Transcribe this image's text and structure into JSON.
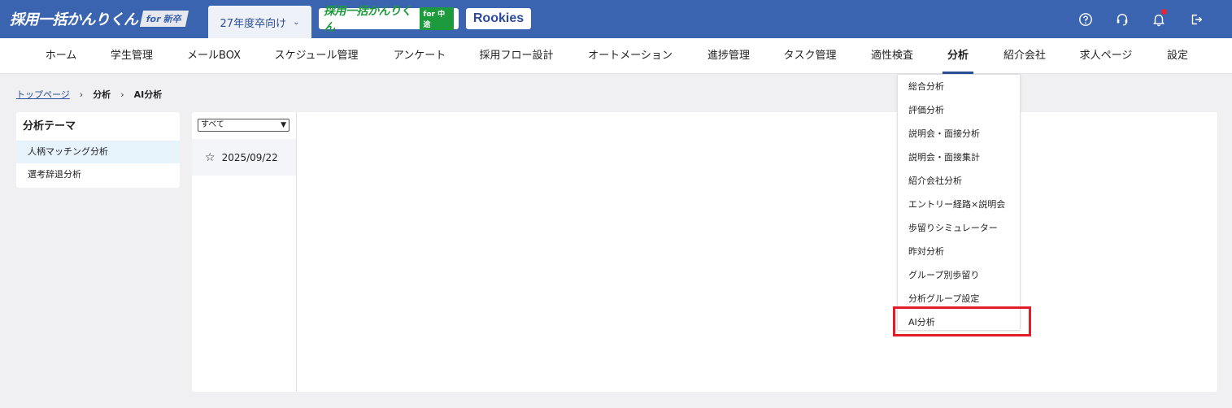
{
  "header": {
    "logo_main": "採用一括かんりくん",
    "logo_main_badge": "for 新卒",
    "year_selector": "27年度卒向け",
    "logo_mid": "採用一括かんりくん",
    "logo_mid_badge": "for 中途",
    "logo_rookies": "Rookies",
    "icons": [
      "help-icon",
      "support-headset-icon",
      "bell-icon",
      "logout-icon"
    ]
  },
  "nav": {
    "items": [
      "ホーム",
      "学生管理",
      "メールBOX",
      "スケジュール管理",
      "アンケート",
      "採用フロー設計",
      "オートメーション",
      "進捗管理",
      "タスク管理",
      "適性検査",
      "分析",
      "紹介会社",
      "求人ページ",
      "設定"
    ],
    "active": "分析"
  },
  "breadcrumb": {
    "home": "トップページ",
    "level1": "分析",
    "current": "AI分析"
  },
  "sidebar": {
    "title": "分析テーマ",
    "items": [
      "人柄マッチング分析",
      "選考辞退分析"
    ]
  },
  "list": {
    "filter": "すべて",
    "entries": [
      "2025/09/22"
    ]
  },
  "dropdown": {
    "items": [
      "総合分析",
      "評価分析",
      "説明会・面接分析",
      "説明会・面接集計",
      "紹介会社分析",
      "エントリー経路×説明会",
      "歩留りシミュレーター",
      "昨対分析",
      "グループ別歩留り",
      "分析グループ設定",
      "AI分析"
    ]
  },
  "colors": {
    "header_bg": "#3a63b0",
    "accent": "#2a4f95",
    "highlight": "#e11d2a",
    "notification": "#e8242e"
  }
}
